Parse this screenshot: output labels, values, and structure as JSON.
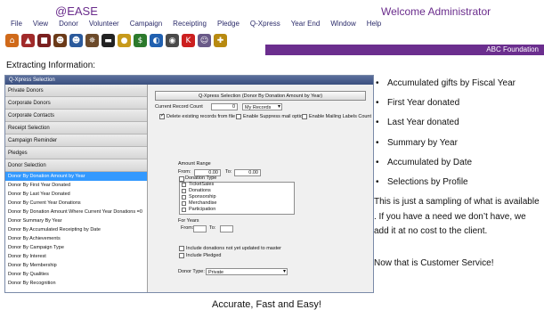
{
  "app": {
    "brand": "@EASE",
    "welcome": "Welcome Administrator",
    "org": "ABC Foundation"
  },
  "menu": [
    "File",
    "View",
    "Donor",
    "Volunteer",
    "Campaign",
    "Receipting",
    "Pledge",
    "Q-Xpress",
    "Year End",
    "Window",
    "Help"
  ],
  "toolbar_icons": [
    {
      "name": "home-icon",
      "glyph": "⌂",
      "color": "#d06a1a"
    },
    {
      "name": "school-icon",
      "glyph": "▲",
      "color": "#a12a2a"
    },
    {
      "name": "briefcase-icon",
      "glyph": "■",
      "color": "#7a2020"
    },
    {
      "name": "people-icon",
      "glyph": "☻",
      "color": "#6b3a18"
    },
    {
      "name": "group-icon",
      "glyph": "☻",
      "color": "#2b5a9c"
    },
    {
      "name": "ship-wheel-icon",
      "glyph": "✵",
      "color": "#6c4a2a"
    },
    {
      "name": "hat-icon",
      "glyph": "▬",
      "color": "#222222"
    },
    {
      "name": "coins-icon",
      "glyph": "●",
      "color": "#c79a1b"
    },
    {
      "name": "money-icon",
      "glyph": "$",
      "color": "#2c7a2c"
    },
    {
      "name": "globe-icon",
      "glyph": "◐",
      "color": "#2060b0"
    },
    {
      "name": "disc-icon",
      "glyph": "◉",
      "color": "#4a4a4a"
    },
    {
      "name": "k-logo-icon",
      "glyph": "K",
      "color": "#cc1f1f"
    },
    {
      "name": "user-icon",
      "glyph": "☺",
      "color": "#6a5a88"
    },
    {
      "name": "wrench-icon",
      "glyph": "✚",
      "color": "#b88a10"
    }
  ],
  "section_label": "Extracting Information:",
  "window": {
    "title": "Q-Xpress Selection",
    "left_headers": [
      "Private Donors",
      "Corporate Donors",
      "Corporate Contacts",
      "Receipt Selection",
      "Campaign Reminder",
      "Pledges",
      "Donor Selection"
    ],
    "left_items": [
      "Donor By Donation Amount by Year",
      "Donor By First Year Donated",
      "Donor By Last Year Donated",
      "Donor By Current Year Donations",
      "Donor By Donation Amount Where Current Year Donations =0",
      "Donor Summary By Year",
      "Donor By Accumulated Receipting by Date",
      "Donor By Achievements",
      "Donor By Campaign Type",
      "Donor By Interest",
      "Donor By Membership",
      "Donor By Qualities",
      "Donor By Recognition"
    ],
    "selected_index": 0,
    "selection_button": "Q-Xpress Selection (Donor By Donation Amount by Year)",
    "current_record_count_label": "Current Record Count",
    "current_record_count_value": "0",
    "records_select": "My Records",
    "delete_existing": "Delete existing records from file",
    "enable_suppress": "Enable Suppress mail option",
    "enable_mailing": "Enable Mailing Labels Count",
    "amount_range_label": "Amount Range",
    "from_label": "From:",
    "from_value": "0.00",
    "to_label": "To:",
    "to_value": "0.00",
    "donation_type_label": "Donation Type",
    "donation_types": [
      "TicketSales",
      "Donations",
      "Sponsorship",
      "Merchandise",
      "Participation"
    ],
    "for_years_label": "For Years",
    "years_from_label": "From:",
    "years_to_label": "To:",
    "include_not_updated": "Include donations not yet updated to master",
    "include_pledged": "Include Pledged",
    "donor_type_label": "Donor Type:",
    "donor_type_value": "Private"
  },
  "caption": "Accurate, Fast and Easy!",
  "bullets": [
    "Accumulated gifts by Fiscal Year",
    "First Year donated",
    "Last Year donated",
    "Summary by Year",
    "Accumulated by Date",
    "Selections by Profile"
  ],
  "paragraph": "This is just a sampling of what is available .  If you have a need we don’t have, we add it at no cost to the client.",
  "paragraph2": "Now that is Customer Service!"
}
